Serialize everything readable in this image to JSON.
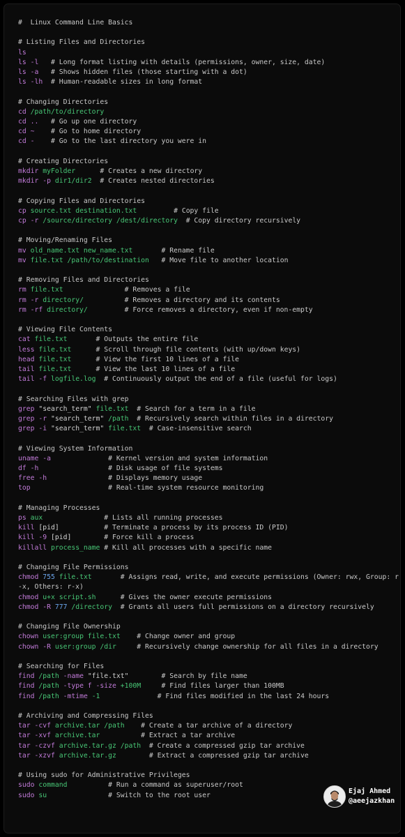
{
  "title": "#  Linux Command Line Basics",
  "colors": {
    "background": "#0b0b0b",
    "comment": "#c9c9c9",
    "command": "#c27bd9",
    "argument": "#48c776",
    "number": "#6ba5ec",
    "default": "#d2d2d2"
  },
  "lines": [
    [
      [
        "com",
        "#  Linux Command Line Basics"
      ]
    ],
    [],
    [
      [
        "com",
        "# Listing Files and Directories"
      ]
    ],
    [
      [
        "cmd",
        "ls"
      ]
    ],
    [
      [
        "cmd",
        "ls -l"
      ],
      [
        "com",
        "   # Long format listing with details (permissions, owner, size, date)"
      ]
    ],
    [
      [
        "cmd",
        "ls -a"
      ],
      [
        "com",
        "   # Shows hidden files (those starting with a dot)"
      ]
    ],
    [
      [
        "cmd",
        "ls -lh"
      ],
      [
        "com",
        "  # Human-readable sizes in long format"
      ]
    ],
    [],
    [
      [
        "com",
        "# Changing Directories"
      ]
    ],
    [
      [
        "cmd",
        "cd "
      ],
      [
        "arg",
        "/path/to/directory"
      ]
    ],
    [
      [
        "cmd",
        "cd .."
      ],
      [
        "com",
        "   # Go up one directory"
      ]
    ],
    [
      [
        "cmd",
        "cd ~"
      ],
      [
        "com",
        "    # Go to home directory"
      ]
    ],
    [
      [
        "cmd",
        "cd -"
      ],
      [
        "com",
        "    # Go to the last directory you were in"
      ]
    ],
    [],
    [
      [
        "com",
        "# Creating Directories"
      ]
    ],
    [
      [
        "cmd",
        "mkdir "
      ],
      [
        "arg",
        "myFolder"
      ],
      [
        "com",
        "      # Creates a new directory"
      ]
    ],
    [
      [
        "cmd",
        "mkdir -p "
      ],
      [
        "arg",
        "dir1/dir2"
      ],
      [
        "com",
        "  # Creates nested directories"
      ]
    ],
    [],
    [
      [
        "com",
        "# Copying Files and Directories"
      ]
    ],
    [
      [
        "cmd",
        "cp "
      ],
      [
        "arg",
        "source.txt destination.txt"
      ],
      [
        "com",
        "         # Copy file"
      ]
    ],
    [
      [
        "cmd",
        "cp -r "
      ],
      [
        "arg",
        "/source/directory /dest/directory"
      ],
      [
        "com",
        "  # Copy directory recursively"
      ]
    ],
    [],
    [
      [
        "com",
        "# Moving/Renaming Files"
      ]
    ],
    [
      [
        "cmd",
        "mv "
      ],
      [
        "arg",
        "old_name.txt new_name.txt"
      ],
      [
        "com",
        "       # Rename file"
      ]
    ],
    [
      [
        "cmd",
        "mv "
      ],
      [
        "arg",
        "file.txt /path/to/destination"
      ],
      [
        "com",
        "   # Move file to another location"
      ]
    ],
    [],
    [
      [
        "com",
        "# Removing Files and Directories"
      ]
    ],
    [
      [
        "cmd",
        "rm "
      ],
      [
        "arg",
        "file.txt"
      ],
      [
        "com",
        "               # Removes a file"
      ]
    ],
    [
      [
        "cmd",
        "rm -r "
      ],
      [
        "arg",
        "directory/"
      ],
      [
        "com",
        "          # Removes a directory and its contents"
      ]
    ],
    [
      [
        "cmd",
        "rm -rf "
      ],
      [
        "arg",
        "directory/"
      ],
      [
        "com",
        "         # Force removes a directory, even if non-empty"
      ]
    ],
    [],
    [
      [
        "com",
        "# Viewing File Contents"
      ]
    ],
    [
      [
        "cmd",
        "cat "
      ],
      [
        "arg",
        "file.txt"
      ],
      [
        "com",
        "       # Outputs the entire file"
      ]
    ],
    [
      [
        "cmd",
        "less "
      ],
      [
        "arg",
        "file.txt"
      ],
      [
        "com",
        "      # Scroll through file contents (with up/down keys)"
      ]
    ],
    [
      [
        "cmd",
        "head "
      ],
      [
        "arg",
        "file.txt"
      ],
      [
        "com",
        "      # View the first 10 lines of a file"
      ]
    ],
    [
      [
        "cmd",
        "tail "
      ],
      [
        "arg",
        "file.txt"
      ],
      [
        "com",
        "      # View the last 10 lines of a file"
      ]
    ],
    [
      [
        "cmd",
        "tail -f "
      ],
      [
        "arg",
        "logfile.log"
      ],
      [
        "com",
        "  # Continuously output the end of a file (useful for logs)"
      ]
    ],
    [],
    [
      [
        "com",
        "# Searching Files with grep"
      ]
    ],
    [
      [
        "cmd",
        "grep "
      ],
      [
        "def",
        "\"search_term\" "
      ],
      [
        "arg",
        "file.txt"
      ],
      [
        "com",
        "  # Search for a term in a file"
      ]
    ],
    [
      [
        "cmd",
        "grep -r "
      ],
      [
        "def",
        "\"search_term\" "
      ],
      [
        "arg",
        "/path"
      ],
      [
        "com",
        "  # Recursively search within files in a directory"
      ]
    ],
    [
      [
        "cmd",
        "grep -i "
      ],
      [
        "def",
        "\"search_term\" "
      ],
      [
        "arg",
        "file.txt"
      ],
      [
        "com",
        "  # Case-insensitive search"
      ]
    ],
    [],
    [
      [
        "com",
        "# Viewing System Information"
      ]
    ],
    [
      [
        "cmd",
        "uname -a"
      ],
      [
        "com",
        "              # Kernel version and system information"
      ]
    ],
    [
      [
        "cmd",
        "df -h"
      ],
      [
        "com",
        "                 # Disk usage of file systems"
      ]
    ],
    [
      [
        "cmd",
        "free -h"
      ],
      [
        "com",
        "               # Displays memory usage"
      ]
    ],
    [
      [
        "cmd",
        "top"
      ],
      [
        "com",
        "                   # Real-time system resource monitoring"
      ]
    ],
    [],
    [
      [
        "com",
        "# Managing Processes"
      ]
    ],
    [
      [
        "cmd",
        "ps "
      ],
      [
        "arg",
        "aux"
      ],
      [
        "com",
        "               # Lists all running processes"
      ]
    ],
    [
      [
        "cmd",
        "kill "
      ],
      [
        "br",
        "[pid]"
      ],
      [
        "com",
        "           # Terminate a process by its process ID (PID)"
      ]
    ],
    [
      [
        "cmd",
        "kill -9 "
      ],
      [
        "br",
        "[pid]"
      ],
      [
        "com",
        "        # Force kill a process"
      ]
    ],
    [
      [
        "cmd",
        "killall "
      ],
      [
        "arg",
        "process_name"
      ],
      [
        "com",
        " # Kill all processes with a specific name"
      ]
    ],
    [],
    [
      [
        "com",
        "# Changing File Permissions"
      ]
    ],
    [
      [
        "cmd",
        "chmod "
      ],
      [
        "num",
        "755 "
      ],
      [
        "arg",
        "file.txt"
      ],
      [
        "com",
        "       # Assigns read, write, and execute permissions (Owner: rwx, Group: r-x, Others: r-x)"
      ]
    ],
    [
      [
        "cmd",
        "chmod "
      ],
      [
        "arg",
        "u+x script.sh"
      ],
      [
        "com",
        "      # Gives the owner execute permissions"
      ]
    ],
    [
      [
        "cmd",
        "chmod -R "
      ],
      [
        "num",
        "777 "
      ],
      [
        "arg",
        "/directory"
      ],
      [
        "com",
        "  # Grants all users full permissions on a directory recursively"
      ]
    ],
    [],
    [
      [
        "com",
        "# Changing File Ownership"
      ]
    ],
    [
      [
        "cmd",
        "chown "
      ],
      [
        "arg",
        "user:group file.txt"
      ],
      [
        "com",
        "    # Change owner and group"
      ]
    ],
    [
      [
        "cmd",
        "chown -R "
      ],
      [
        "arg",
        "user:group /dir"
      ],
      [
        "com",
        "     # Recursively change ownership for all files in a directory"
      ]
    ],
    [],
    [
      [
        "com",
        "# Searching for Files"
      ]
    ],
    [
      [
        "cmd",
        "find "
      ],
      [
        "arg",
        "/path"
      ],
      [
        "cmd",
        " -name "
      ],
      [
        "def",
        "\"file.txt\""
      ],
      [
        "com",
        "        # Search by file name"
      ]
    ],
    [
      [
        "cmd",
        "find "
      ],
      [
        "arg",
        "/path"
      ],
      [
        "cmd",
        " -type f -size "
      ],
      [
        "arg",
        "+100M"
      ],
      [
        "com",
        "     # Find files larger than 100MB"
      ]
    ],
    [
      [
        "cmd",
        "find "
      ],
      [
        "arg",
        "/path"
      ],
      [
        "cmd",
        " -mtime "
      ],
      [
        "arg",
        "-1"
      ],
      [
        "com",
        "              # Find files modified in the last 24 hours"
      ]
    ],
    [],
    [
      [
        "com",
        "# Archiving and Compressing Files"
      ]
    ],
    [
      [
        "cmd",
        "tar -cvf "
      ],
      [
        "arg",
        "archive.tar /path"
      ],
      [
        "com",
        "    # Create a tar archive of a directory"
      ]
    ],
    [
      [
        "cmd",
        "tar -xvf "
      ],
      [
        "arg",
        "archive.tar"
      ],
      [
        "com",
        "          # Extract a tar archive"
      ]
    ],
    [
      [
        "cmd",
        "tar -czvf "
      ],
      [
        "arg",
        "archive.tar.gz /path"
      ],
      [
        "com",
        "  # Create a compressed gzip tar archive"
      ]
    ],
    [
      [
        "cmd",
        "tar -xzvf "
      ],
      [
        "arg",
        "archive.tar.gz"
      ],
      [
        "com",
        "        # Extract a compressed gzip tar archive"
      ]
    ],
    [],
    [
      [
        "com",
        "# Using sudo for Administrative Privileges"
      ]
    ],
    [
      [
        "cmd",
        "sudo "
      ],
      [
        "arg",
        "command"
      ],
      [
        "com",
        "          # Run a command as superuser/root"
      ]
    ],
    [
      [
        "cmd",
        "sudo "
      ],
      [
        "arg",
        "su"
      ],
      [
        "com",
        "               # Switch to the root user"
      ]
    ]
  ],
  "author": {
    "name": "Ejaj Ahmed",
    "handle": "@aeejazkhan"
  }
}
